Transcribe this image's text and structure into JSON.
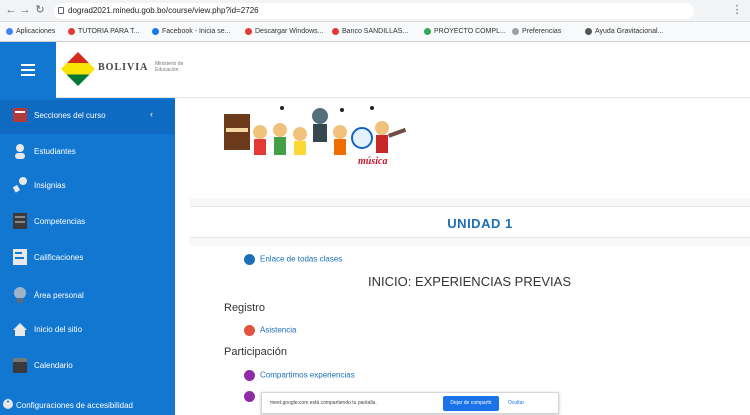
{
  "browser": {
    "url": "dograd2021.minedu.gob.bo/course/view.php?id=2726",
    "bookmarks": [
      "Aplicaciones",
      "TUTORIA PARA T...",
      "Facebook - Inicia se...",
      "Descargar Windows...",
      "Banco SANDILLAS...",
      "PROYECTO COMPL...",
      "Preferencias",
      "Ayuda Gravitacional..."
    ]
  },
  "navbar": {
    "logo_text": "BOLIVIA",
    "logo_sub": "Ministerio de Educación"
  },
  "drawer": {
    "items": [
      {
        "label": "Secciones del curso"
      },
      {
        "label": "Estudiantes"
      },
      {
        "label": "Insignias"
      },
      {
        "label": "Competencias"
      },
      {
        "label": "Calificaciones"
      },
      {
        "label": "Área personal"
      },
      {
        "label": "Inicio del sitio"
      },
      {
        "label": "Calendario"
      },
      {
        "label": "Configuraciones de accesibilidad"
      }
    ]
  },
  "main": {
    "banner_word": "música",
    "unit_title": "UNIDAD 1",
    "link_classes": "Enlace de todas clases",
    "heading": "INICIO: EXPERIENCIAS PREVIAS",
    "registro": "Registro",
    "asistencia": "Asistencia",
    "participacion": "Participación",
    "compartimos": "Compartimos experiencias"
  },
  "share": {
    "text": "meet.google.com está compartiendo tu pantalla.",
    "stop": "Dejar de compartir",
    "hide": "Ocultar"
  },
  "colors": {
    "accent": "#1177d1",
    "link": "#1d6fb8",
    "icon_red": "#e1533c",
    "icon_purple": "#8e2ca8"
  }
}
